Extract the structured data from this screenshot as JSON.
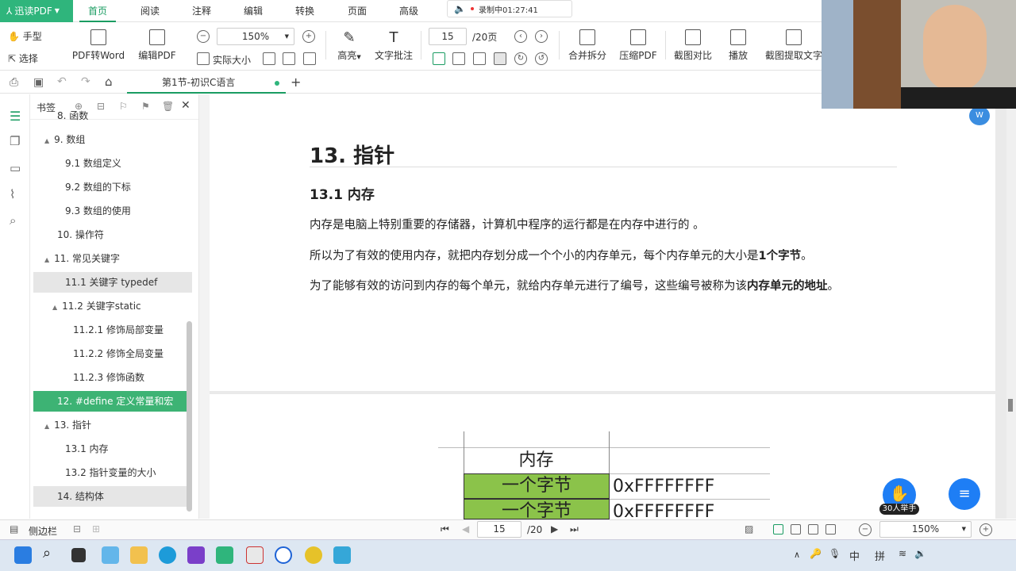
{
  "app": {
    "name": "迅读PDF",
    "accent": "#2fb57c"
  },
  "menu": {
    "items": [
      "首页",
      "阅读",
      "注释",
      "编辑",
      "转换",
      "页面",
      "高级"
    ],
    "active": "首页"
  },
  "recording": {
    "label": "录制中01:27:41"
  },
  "toolbar": {
    "hand": "手型",
    "select": "选择",
    "pdf_to_word": "PDF转Word",
    "edit_pdf": "编辑PDF",
    "zoom": "150%",
    "actual_size": "实际大小",
    "highlight": "高亮",
    "text_note": "文字批注",
    "page_current": "15",
    "page_total": "/20页",
    "merge_split": "合并拆分",
    "compress": "压缩PDF",
    "screenshot_compare": "截图对比",
    "play": "播放",
    "ocr_text": "截图提取文字"
  },
  "tab": {
    "title": "第1节-初识C语言",
    "add": "+"
  },
  "bookmarks": {
    "title": "书签",
    "items": [
      {
        "label": "8. 函数",
        "level": 1,
        "state": ""
      },
      {
        "label": "9. 数组",
        "level": 1,
        "state": "",
        "toggle": "▲"
      },
      {
        "label": "9.1 数组定义",
        "level": 2,
        "state": ""
      },
      {
        "label": "9.2 数组的下标",
        "level": 2,
        "state": ""
      },
      {
        "label": "9.3 数组的使用",
        "level": 2,
        "state": ""
      },
      {
        "label": "10. 操作符",
        "level": 1,
        "state": ""
      },
      {
        "label": "11. 常见关键字",
        "level": 1,
        "state": "",
        "toggle": "▲"
      },
      {
        "label": "11.1 关键字 typedef",
        "level": 2,
        "state": "hover"
      },
      {
        "label": "11.2 关键字static",
        "level": 2,
        "state": "",
        "toggle": "▲"
      },
      {
        "label": "11.2.1 修饰局部变量",
        "level": 3,
        "state": ""
      },
      {
        "label": "11.2.2 修饰全局变量",
        "level": 3,
        "state": ""
      },
      {
        "label": "11.2.3 修饰函数",
        "level": 3,
        "state": ""
      },
      {
        "label": "12. #define 定义常量和宏",
        "level": 1,
        "state": "sel"
      },
      {
        "label": "13. 指针",
        "level": 1,
        "state": "",
        "toggle": "▲"
      },
      {
        "label": "13.1 内存",
        "level": 2,
        "state": ""
      },
      {
        "label": "13.2 指针变量的大小",
        "level": 2,
        "state": ""
      },
      {
        "label": "14. 结构体",
        "level": 1,
        "state": "hover"
      }
    ]
  },
  "document": {
    "h1": "13. 指针",
    "h2": "13.1 内存",
    "p1": "内存是电脑上特别重要的存储器，计算机中程序的运行都是在内存中进行的 。",
    "p2_a": "所以为了有效的使用内存，就把内存划分成一个个小的内存单元，每个内存单元的大小是",
    "p2_b": "1个字节",
    "p2_c": "。",
    "p3_a": "为了能够有效的访问到内存的每个单元，就给内存单元进行了编号，这些编号被称为该",
    "p3_b": "内存单元的地址",
    "p3_c": "。",
    "table": {
      "header": "内存",
      "rows": [
        {
          "cell": "一个字节",
          "addr": "0xFFFFFFFF"
        },
        {
          "cell": "一个字节",
          "addr": "0xFFFFFFFF"
        }
      ]
    }
  },
  "floating": {
    "raise_count": "30人举手"
  },
  "statusbar": {
    "sidebar": "侧边栏",
    "page_current": "15",
    "page_total": "/20",
    "zoom": "150%"
  },
  "taskbar": {
    "ime1": "中",
    "ime2": "拼"
  }
}
